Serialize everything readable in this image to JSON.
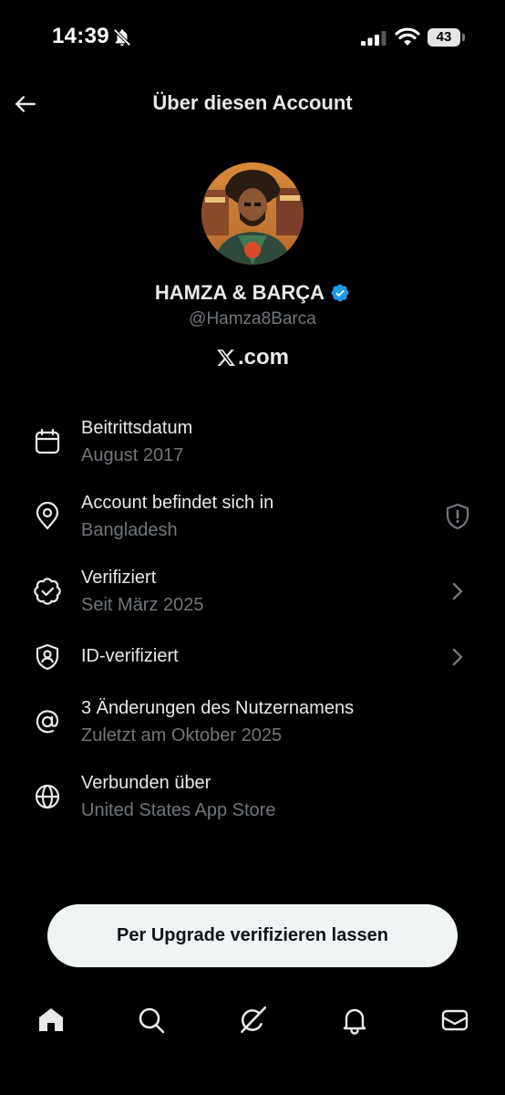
{
  "status_bar": {
    "time": "14:39",
    "battery": "43"
  },
  "header": {
    "title": "Über diesen Account"
  },
  "profile": {
    "display_name": "HAMZA & BARÇA",
    "handle": "@Hamza8Barca",
    "brand_text": ".com"
  },
  "info": {
    "items": [
      {
        "icon": "calendar-icon",
        "title": "Beitrittsdatum",
        "subtitle": "August 2017"
      },
      {
        "icon": "location-pin-icon",
        "title": "Account befindet sich in",
        "subtitle": "Bangladesh",
        "right_icon": "shield-alert-icon"
      },
      {
        "icon": "verified-seal-icon",
        "title": "Verifiziert",
        "subtitle": "Seit März 2025",
        "right_icon": "chevron-right-icon"
      },
      {
        "icon": "id-shield-icon",
        "title": "ID-verifiziert",
        "right_icon": "chevron-right-icon"
      },
      {
        "icon": "at-sign-icon",
        "title": "3 Änderungen des Nutzernamens",
        "subtitle": "Zuletzt am Oktober 2025"
      },
      {
        "icon": "globe-icon",
        "title": "Verbunden über",
        "subtitle": "United States App Store"
      }
    ]
  },
  "actions": {
    "upgrade_label": "Per Upgrade verifizieren lassen"
  },
  "nav": {
    "items": [
      "home-icon",
      "search-icon",
      "grok-icon",
      "bell-icon",
      "mail-icon"
    ]
  },
  "colors": {
    "background": "#000000",
    "text_primary": "#e7e9ea",
    "text_secondary": "#71767b",
    "verified_blue": "#1d9bf0",
    "button_bg": "#eff3f4"
  }
}
